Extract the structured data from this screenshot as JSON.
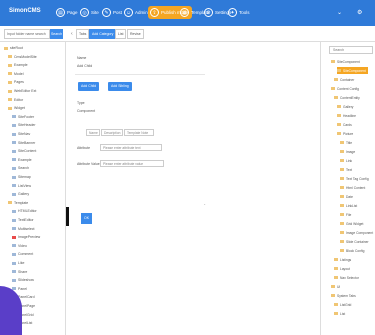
{
  "app": {
    "logo": "SimonCMS"
  },
  "top_tabs": [
    {
      "label": "Page",
      "icon": "page-icon",
      "active": false
    },
    {
      "label": "Site",
      "icon": "site-icon",
      "active": false
    },
    {
      "label": "Post",
      "icon": "post-icon",
      "active": false
    },
    {
      "label": "Admin",
      "icon": "admin-icon",
      "active": false
    },
    {
      "label": "Publish mode",
      "icon": "publish-icon",
      "active": true
    },
    {
      "label": "Template",
      "icon": "template-icon",
      "active": false
    },
    {
      "label": "Settings",
      "icon": "settings-icon",
      "active": false
    },
    {
      "label": "Tools",
      "icon": "tools-icon",
      "active": false
    }
  ],
  "top_right": {
    "chevron": "⌄",
    "icon": "⚙"
  },
  "subheader": {
    "search_placeholder": "Input folder name search",
    "search_button": "Search",
    "back": "‹",
    "breadcrumbs": [
      {
        "label": "Tabs",
        "active": false
      },
      {
        "label": "Add Category",
        "active": true
      },
      {
        "label": "List",
        "active": false
      },
      {
        "label": "Revise",
        "active": false
      }
    ]
  },
  "sidebar": {
    "items": [
      {
        "label": "siteRoot",
        "type": "folder",
        "indent": 0
      },
      {
        "label": "CmsModelSite",
        "type": "folder",
        "indent": 1
      },
      {
        "label": "Example",
        "type": "folder",
        "indent": 1
      },
      {
        "label": "Model",
        "type": "folder",
        "indent": 1
      },
      {
        "label": "Pages",
        "type": "folder",
        "indent": 1
      },
      {
        "label": "WebEditor Ext",
        "type": "folder",
        "indent": 1
      },
      {
        "label": "Editor",
        "type": "folder",
        "indent": 1
      },
      {
        "label": "Widget",
        "type": "folder",
        "indent": 1
      },
      {
        "label": "SiteFooter",
        "type": "doc",
        "indent": 2
      },
      {
        "label": "SiteHeader",
        "type": "doc",
        "indent": 2
      },
      {
        "label": "SiteNav",
        "type": "doc",
        "indent": 2
      },
      {
        "label": "SiteBanner",
        "type": "doc",
        "indent": 2
      },
      {
        "label": "SiteContent",
        "type": "doc",
        "indent": 2
      },
      {
        "label": "Example",
        "type": "doc",
        "indent": 2
      },
      {
        "label": "Search",
        "type": "doc",
        "indent": 2
      },
      {
        "label": "Sitemap",
        "type": "doc",
        "indent": 2
      },
      {
        "label": "ListView",
        "type": "doc",
        "indent": 2
      },
      {
        "label": "Gallery",
        "type": "doc",
        "indent": 2
      },
      {
        "label": "Template",
        "type": "folder",
        "indent": 1
      },
      {
        "label": "HTMLEditor",
        "type": "doc",
        "indent": 2
      },
      {
        "label": "TextEditor",
        "type": "doc",
        "indent": 2
      },
      {
        "label": "Multiselect",
        "type": "doc",
        "indent": 2
      },
      {
        "label": "ImagePreview",
        "type": "red",
        "indent": 2
      },
      {
        "label": "Video",
        "type": "doc",
        "indent": 2
      },
      {
        "label": "Comment",
        "type": "doc",
        "indent": 2
      },
      {
        "label": "Like",
        "type": "doc",
        "indent": 2
      },
      {
        "label": "Share",
        "type": "doc",
        "indent": 2
      },
      {
        "label": "Slideshow",
        "type": "doc",
        "indent": 2
      },
      {
        "label": "Panel",
        "type": "doc",
        "indent": 2
      },
      {
        "label": "PanelCard",
        "type": "doc",
        "indent": 2
      },
      {
        "label": "PanelPage",
        "type": "doc",
        "indent": 2
      },
      {
        "label": "PanelGrid",
        "type": "doc",
        "indent": 2
      },
      {
        "label": "PanelList",
        "type": "doc",
        "indent": 2
      }
    ]
  },
  "main": {
    "name_label": "Name",
    "name_value": "Add Child",
    "btn_add_child": "Add Child",
    "btn_add_sibling": "Add Sibling",
    "type_label": "Type",
    "type_value": "Component",
    "filter_tabs": [
      "Name",
      "Description",
      "Template Note"
    ],
    "field1_label": "Attribute",
    "field1_placeholder": "Please enter attribute text",
    "field2_label": "Attribute Value",
    "field2_placeholder": "Please enter attribute value",
    "dot": "·",
    "ok_button": "OK"
  },
  "right_panel": {
    "search_placeholder": "Search",
    "items": [
      {
        "label": "SiteComponent",
        "indent": 0,
        "highlight": false
      },
      {
        "label": "SiteComponent",
        "indent": 2,
        "highlight": true
      },
      {
        "label": "Container",
        "indent": 1,
        "highlight": false
      },
      {
        "label": "Content Config",
        "indent": 0,
        "highlight": false
      },
      {
        "label": "ContentEntity",
        "indent": 1,
        "highlight": false
      },
      {
        "label": "Gallery",
        "indent": 2,
        "highlight": false
      },
      {
        "label": "Headline",
        "indent": 2,
        "highlight": false
      },
      {
        "label": "Cards",
        "indent": 2,
        "highlight": false
      },
      {
        "label": "Picture",
        "indent": 2,
        "highlight": false
      },
      {
        "label": "Title",
        "indent": 3,
        "highlight": false
      },
      {
        "label": "Image",
        "indent": 3,
        "highlight": false
      },
      {
        "label": "Link",
        "indent": 3,
        "highlight": false
      },
      {
        "label": "Text",
        "indent": 3,
        "highlight": false
      },
      {
        "label": "Text Tag Config",
        "indent": 3,
        "highlight": false
      },
      {
        "label": "Html Content",
        "indent": 3,
        "highlight": false
      },
      {
        "label": "Date",
        "indent": 3,
        "highlight": false
      },
      {
        "label": "LinkList",
        "indent": 3,
        "highlight": false
      },
      {
        "label": "File",
        "indent": 3,
        "highlight": false
      },
      {
        "label": "Grid Widget",
        "indent": 3,
        "highlight": false
      },
      {
        "label": "Image Component",
        "indent": 3,
        "highlight": false
      },
      {
        "label": "Slide Container",
        "indent": 3,
        "highlight": false
      },
      {
        "label": "Block Config",
        "indent": 3,
        "highlight": false
      },
      {
        "label": "Listings",
        "indent": 1,
        "highlight": false
      },
      {
        "label": "Layout",
        "indent": 1,
        "highlight": false
      },
      {
        "label": "Nav Selector",
        "indent": 1,
        "highlight": false
      },
      {
        "label": "UI",
        "indent": 0,
        "highlight": false
      },
      {
        "label": "System Tabs",
        "indent": 0,
        "highlight": false
      },
      {
        "label": "ListGrid",
        "indent": 1,
        "highlight": false
      },
      {
        "label": "List",
        "indent": 1,
        "highlight": false
      }
    ]
  }
}
